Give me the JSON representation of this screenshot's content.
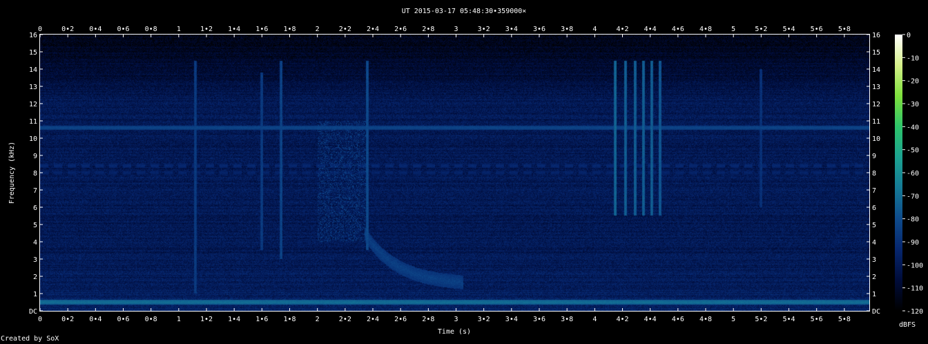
{
  "footer": {
    "credit": "Created by SoX"
  },
  "chart_data": {
    "type": "heatmap",
    "title": "UT 2015-03-17 05:48:30•359000×",
    "xlabel": "Time (s)",
    "ylabel": "Frequency (kHz)",
    "xlim": [
      0,
      5.98
    ],
    "ylim": [
      0,
      16
    ],
    "x_ticks": [
      "0",
      "0•2",
      "0•4",
      "0•6",
      "0•8",
      "1",
      "1•2",
      "1•4",
      "1•6",
      "1•8",
      "2",
      "2•2",
      "2•4",
      "2•6",
      "2•8",
      "3",
      "3•2",
      "3•4",
      "3•6",
      "3•8",
      "4",
      "4•2",
      "4•4",
      "4•6",
      "4•8",
      "5",
      "5•2",
      "5•4",
      "5•6",
      "5•8"
    ],
    "y_ticks": [
      "DC",
      "1",
      "2",
      "3",
      "4",
      "5",
      "6",
      "7",
      "8",
      "9",
      "10",
      "11",
      "12",
      "13",
      "14",
      "15",
      "16"
    ],
    "colorbar": {
      "unit": "dBFS",
      "range": [
        -120,
        0
      ],
      "ticks": [
        "0",
        "-10",
        "-20",
        "-30",
        "-40",
        "-50",
        "-60",
        "-70",
        "-80",
        "-90",
        "-100",
        "-110",
        "-120"
      ],
      "colors": [
        "#000000",
        "#000c3a",
        "#06266e",
        "#0e4b8c",
        "#157a96",
        "#1ca392",
        "#2dc46a",
        "#7ee03c",
        "#d6f08a",
        "#ffffff"
      ]
    },
    "features": {
      "background_level_dbfs": -100,
      "horizontal_lines_khz": [
        {
          "freq": 0.5,
          "level": -70
        },
        {
          "freq": 10.6,
          "level": -82
        },
        {
          "freq": 8.4,
          "level": -92,
          "dashed": true
        },
        {
          "freq": 8.0,
          "level": -94,
          "dashed": true
        }
      ],
      "vertical_bursts": [
        {
          "t": 1.12,
          "f_lo": 1.0,
          "f_hi": 14.5,
          "level": -85
        },
        {
          "t": 1.6,
          "f_lo": 3.5,
          "f_hi": 13.8,
          "level": -85
        },
        {
          "t": 1.74,
          "f_lo": 3.0,
          "f_hi": 14.5,
          "level": -82
        },
        {
          "t": 2.36,
          "f_lo": 3.5,
          "f_hi": 14.5,
          "level": -80
        },
        {
          "t": 4.15,
          "f_lo": 5.5,
          "f_hi": 14.5,
          "level": -72
        },
        {
          "t": 4.22,
          "f_lo": 5.5,
          "f_hi": 14.5,
          "level": -74
        },
        {
          "t": 4.29,
          "f_lo": 5.5,
          "f_hi": 14.5,
          "level": -74
        },
        {
          "t": 4.35,
          "f_lo": 5.5,
          "f_hi": 14.5,
          "level": -74
        },
        {
          "t": 4.41,
          "f_lo": 5.5,
          "f_hi": 14.5,
          "level": -74
        },
        {
          "t": 4.47,
          "f_lo": 5.5,
          "f_hi": 14.5,
          "level": -76
        },
        {
          "t": 5.2,
          "f_lo": 6.0,
          "f_hi": 14.0,
          "level": -88
        }
      ],
      "whistler": {
        "t_start": 2.34,
        "t_end": 3.05,
        "f_start": 4.5,
        "f_end": 1.5,
        "level": -84
      }
    }
  }
}
